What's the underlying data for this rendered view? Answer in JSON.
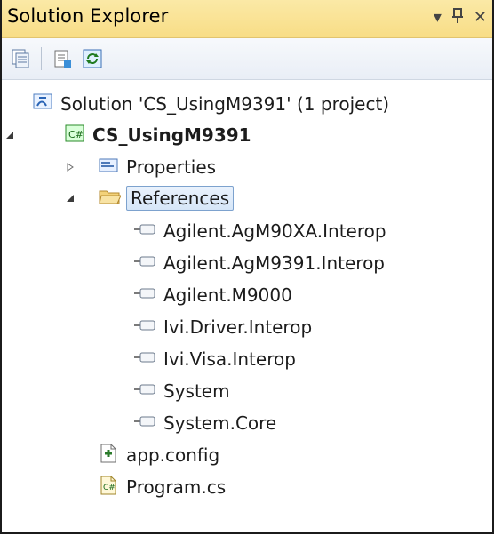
{
  "window": {
    "title": "Solution Explorer",
    "buttons": {
      "dropdown": "▾",
      "pin": "⊥",
      "close": "✕"
    }
  },
  "toolbar": {
    "icons": [
      "show-all-files-icon",
      "properties-icon",
      "refresh-icon"
    ]
  },
  "tree": {
    "solution": {
      "label": "Solution 'CS_UsingM9391' (1 project)",
      "icon": "solution-icon"
    },
    "project": {
      "label": "CS_UsingM9391",
      "icon": "csharp-project-icon",
      "expanded": true
    },
    "properties": {
      "label": "Properties",
      "icon": "properties-folder-icon",
      "expanded": false
    },
    "references": {
      "label": "References",
      "icon": "folder-open-icon",
      "expanded": true,
      "selected": true,
      "items": [
        {
          "label": "Agilent.AgM90XA.Interop"
        },
        {
          "label": "Agilent.AgM9391.Interop"
        },
        {
          "label": "Agilent.M9000"
        },
        {
          "label": "Ivi.Driver.Interop"
        },
        {
          "label": "Ivi.Visa.Interop"
        },
        {
          "label": "System"
        },
        {
          "label": "System.Core"
        }
      ]
    },
    "files": [
      {
        "label": "app.config",
        "icon": "config-file-icon"
      },
      {
        "label": "Program.cs",
        "icon": "csharp-file-icon"
      }
    ]
  },
  "colors": {
    "title_bg": "#f8dd86",
    "selection_border": "#7da2ce",
    "selection_bg": "#d6e6f8"
  }
}
